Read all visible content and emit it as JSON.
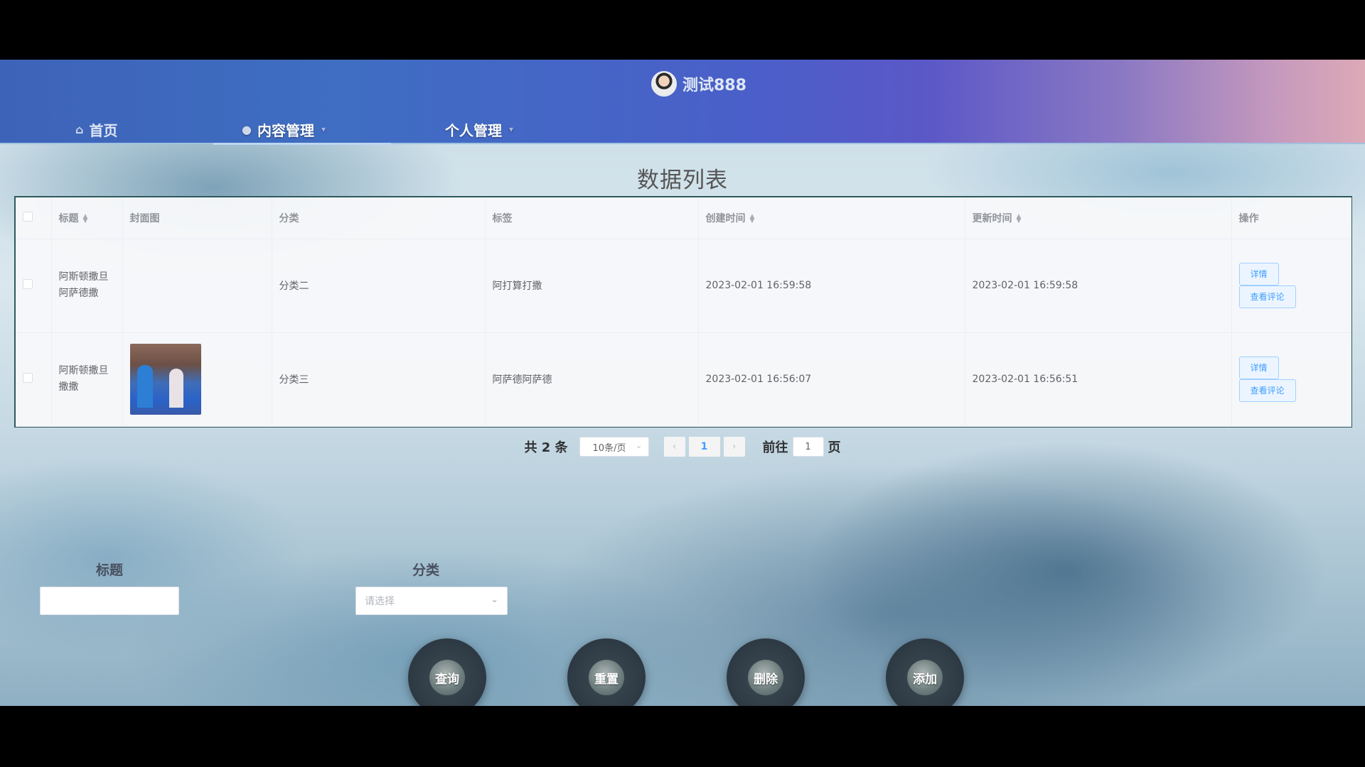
{
  "header": {
    "username": "测试888",
    "nav": [
      {
        "label": "首页",
        "icon": "home-icon"
      },
      {
        "label": "内容管理",
        "icon": "circle-icon"
      },
      {
        "label": "个人管理"
      }
    ]
  },
  "page_title": "数据列表",
  "table": {
    "columns": [
      "标题",
      "封面图",
      "分类",
      "标签",
      "创建时间",
      "更新时间",
      "操作"
    ],
    "rows": [
      {
        "title": "阿斯顿撒旦阿萨德撒",
        "cover": "",
        "category": "分类二",
        "tag": "阿打算打撒",
        "created": "2023-02-01 16:59:58",
        "updated": "2023-02-01 16:59:58",
        "actions": [
          "详情",
          "查看评论"
        ]
      },
      {
        "title": "阿斯顿撒旦撒撒",
        "cover": "image",
        "category": "分类三",
        "tag": "阿萨德阿萨德",
        "created": "2023-02-01 16:56:07",
        "updated": "2023-02-01 16:56:51",
        "actions": [
          "详情",
          "查看评论"
        ]
      }
    ]
  },
  "pagination": {
    "total": "共 2 条",
    "page_size": "10条/页",
    "current_page": "1",
    "goto_label": "前往",
    "goto_value": "1",
    "page_unit": "页"
  },
  "search": {
    "title_label": "标题",
    "title_value": "",
    "category_label": "分类",
    "category_placeholder": "请选择"
  },
  "buttons": {
    "query": "查询",
    "reset": "重置",
    "delete": "删除",
    "add": "添加"
  }
}
